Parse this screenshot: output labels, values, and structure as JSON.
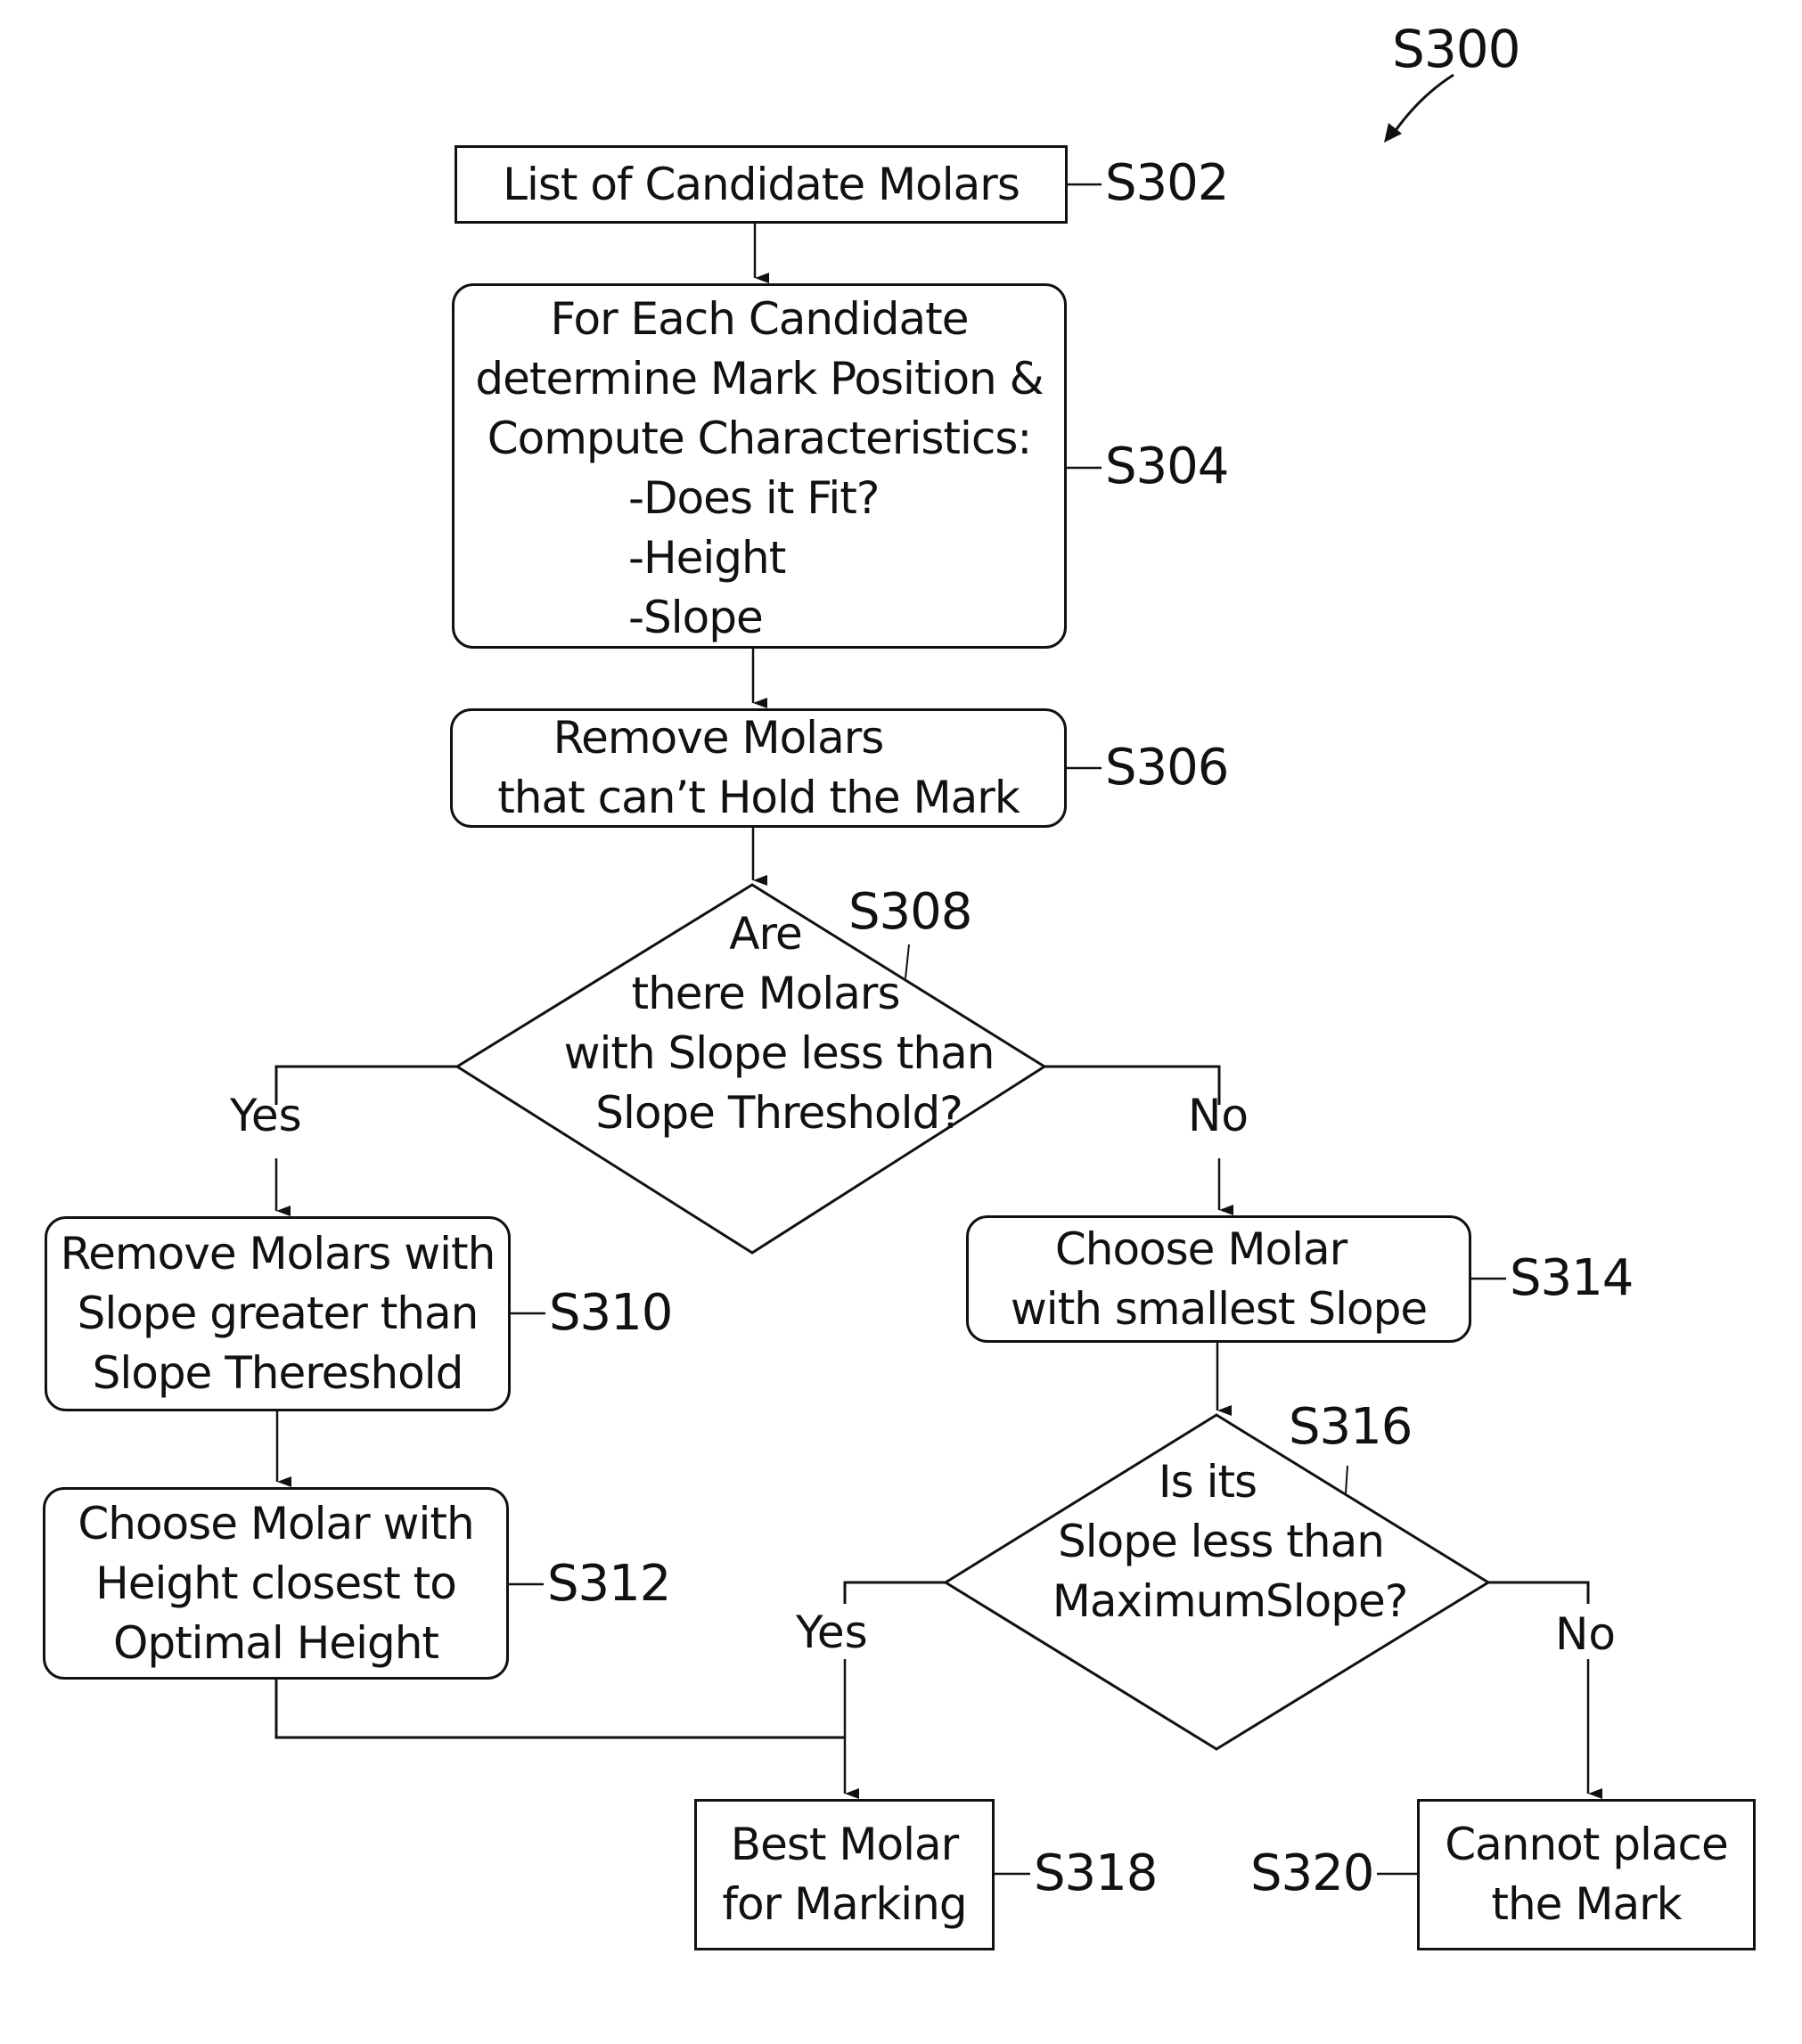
{
  "figure_label": "S300",
  "nodes": {
    "s302": {
      "ref": "S302",
      "lines": [
        "List of Candidate Molars"
      ]
    },
    "s304": {
      "ref": "S304",
      "lines": [
        "For Each Candidate",
        "determine Mark Position &",
        "Compute Characteristics:"
      ],
      "list": [
        "-Does it Fit?",
        "-Height",
        "-Slope"
      ]
    },
    "s306": {
      "ref": "S306",
      "lines": [
        "Remove Molars",
        "that can’t Hold the Mark"
      ]
    },
    "s308": {
      "ref": "S308",
      "lines": [
        "Are",
        "there Molars",
        "with Slope less than",
        "Slope Threshold?"
      ],
      "yes": "Yes",
      "no": "No"
    },
    "s310": {
      "ref": "S310",
      "lines": [
        "Remove Molars with",
        "Slope greater than",
        "Slope Thereshold"
      ]
    },
    "s312": {
      "ref": "S312",
      "lines": [
        "Choose Molar with",
        "Height closest to",
        "Optimal Height"
      ]
    },
    "s314": {
      "ref": "S314",
      "lines": [
        "Choose Molar",
        "with smallest Slope"
      ]
    },
    "s316": {
      "ref": "S316",
      "lines": [
        "Is its",
        "Slope less than",
        "MaximumSlope?"
      ],
      "yes": "Yes",
      "no": "No"
    },
    "s318": {
      "ref": "S318",
      "lines": [
        "Best Molar",
        "for Marking"
      ]
    },
    "s320": {
      "ref": "S320",
      "lines": [
        "Cannot place",
        "the Mark"
      ]
    }
  }
}
